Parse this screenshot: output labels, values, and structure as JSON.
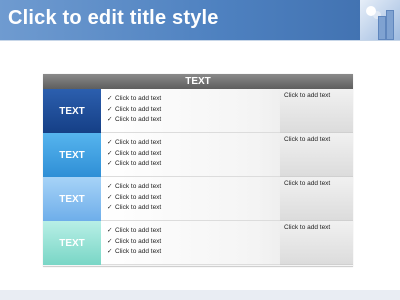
{
  "slide": {
    "title": "Click to edit title style"
  },
  "table": {
    "header": "TEXT",
    "rows": [
      {
        "label": "TEXT",
        "color": "#1f4f9c",
        "items": [
          "Click to add text",
          "Click to add text",
          "Click to add text"
        ],
        "side": "Click to add text"
      },
      {
        "label": "TEXT",
        "color": "#3c9fe0",
        "items": [
          "Click to add text",
          "Click to add text",
          "Click to add text"
        ],
        "side": "Click to add text"
      },
      {
        "label": "TEXT",
        "color": "#7db9ef",
        "items": [
          "Click to add text",
          "Click to add text",
          "Click to add text"
        ],
        "side": "Click to add text"
      },
      {
        "label": "TEXT",
        "color": "#8fe1d2",
        "items": [
          "Click to add text",
          "Click to add text",
          "Click to add text"
        ],
        "side": "Click to add text"
      }
    ],
    "check_glyph": "✓"
  }
}
